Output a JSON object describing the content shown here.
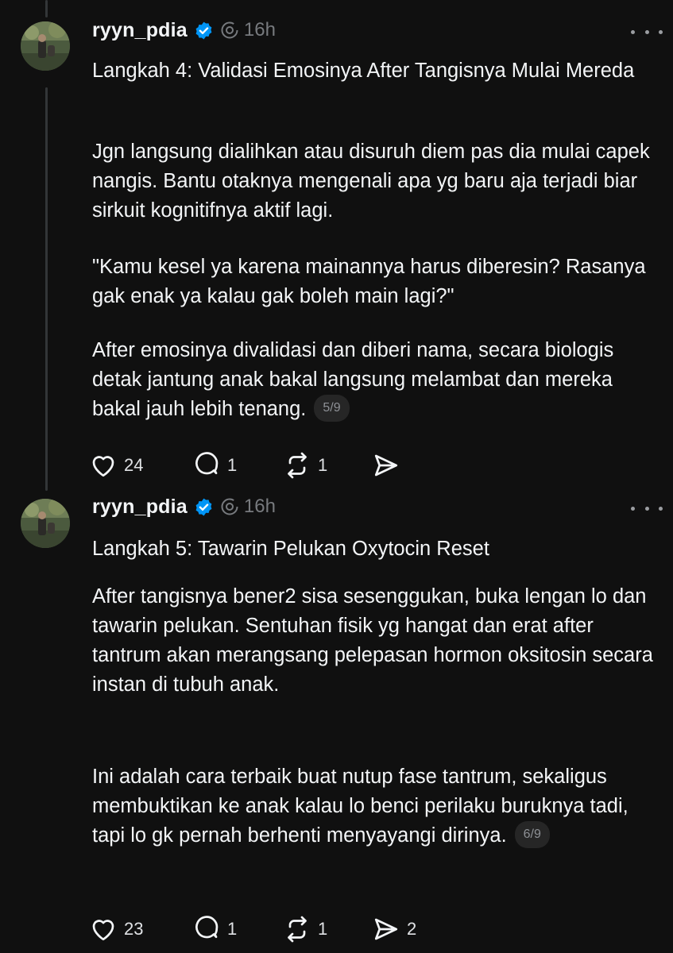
{
  "colors": {
    "background": "#101010",
    "text": "#f3f5f7",
    "muted": "#777a7e",
    "verified": "#0095f6",
    "badge_bg": "#262626",
    "thread_line": "#333638"
  },
  "posts": [
    {
      "username": "ryyn_pdia",
      "verified": true,
      "time": "16h",
      "paragraphs": [
        "Langkah 4: Validasi Emosinya After Tangisnya Mulai Mereda",
        "Jgn langsung dialihkan atau disuruh diem pas dia mulai capek nangis. Bantu otaknya mengenali apa yg baru aja terjadi biar sirkuit kognitifnya aktif lagi.",
        "\"Kamu kesel ya karena mainannya harus diberesin? Rasanya gak enak ya kalau gak boleh main lagi?\"",
        "After emosinya divalidasi dan diberi nama, secara biologis detak jantung anak bakal langsung melambat dan mereka bakal jauh lebih tenang."
      ],
      "page_badge": "5/9",
      "actions": {
        "likes": "24",
        "replies": "1",
        "reposts": "1",
        "shares": ""
      }
    },
    {
      "username": "ryyn_pdia",
      "verified": true,
      "time": "16h",
      "paragraphs": [
        "Langkah 5: Tawarin Pelukan Oxytocin Reset",
        "After tangisnya bener2 sisa sesenggukan, buka lengan lo dan tawarin pelukan. Sentuhan fisik yg hangat dan erat after tantrum akan merangsang pelepasan hormon oksitosin secara instan di tubuh anak.",
        "Ini adalah cara terbaik buat nutup fase tantrum, sekaligus membuktikan ke anak kalau lo benci perilaku buruknya tadi, tapi lo gk pernah berhenti menyayangi dirinya."
      ],
      "page_badge": "6/9",
      "actions": {
        "likes": "23",
        "replies": "1",
        "reposts": "1",
        "shares": "2"
      }
    }
  ],
  "icons": {
    "avatar": "profile-photo",
    "verified": "verified-check-icon",
    "threads": "threads-logo-icon",
    "more": "more-dots-icon",
    "like": "heart-icon",
    "reply": "comment-icon",
    "repost": "repost-icon",
    "share": "send-icon"
  }
}
